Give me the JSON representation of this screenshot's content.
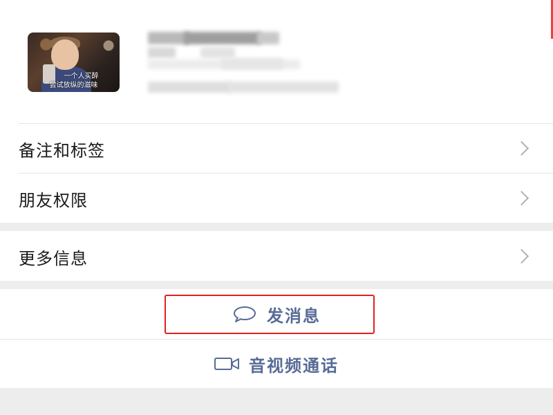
{
  "profile": {
    "avatar_caption_line1": "一个人买醉",
    "avatar_caption_line2": "尝试放纵的滋味"
  },
  "settings_group1": [
    {
      "label": "备注和标签"
    },
    {
      "label": "朋友权限"
    }
  ],
  "settings_group2": [
    {
      "label": "更多信息"
    }
  ],
  "actions": {
    "send_message_label": "发消息",
    "av_call_label": "音视频通话"
  },
  "colors": {
    "link_blue": "#576b95",
    "highlight_red": "#e02020",
    "background_gray": "#ededed"
  },
  "icons": {
    "send_message": "chat-bubble-icon",
    "av_call": "video-camera-icon",
    "row_chevron": "chevron-right-icon"
  }
}
